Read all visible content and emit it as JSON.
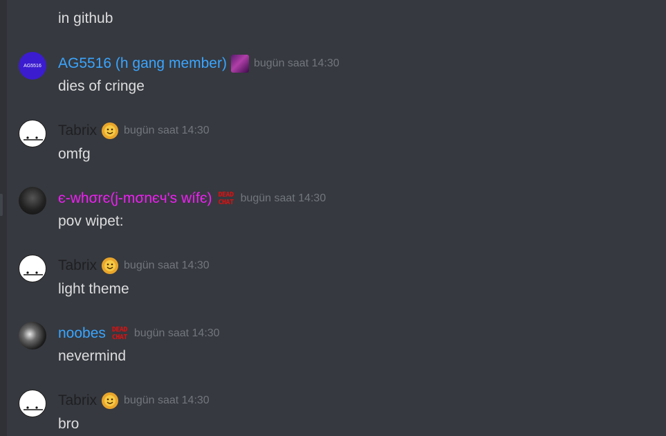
{
  "top_message": {
    "text": "in github"
  },
  "messages": [
    {
      "username": "AG5516 (h gang member)",
      "username_color": "#3aa5ff",
      "avatar_text": "AG5516",
      "badge": "pixel-avatar-badge",
      "timestamp": "bugün saat 14:30",
      "text": "dies of cringe"
    },
    {
      "username": "Tabrix",
      "username_color": "#d9dadc",
      "badge": "sun-emoji-badge",
      "timestamp": "bugün saat 14:30",
      "text": "omfg"
    },
    {
      "username": "є-whσrє(j-mσnєч's wífє)",
      "username_color": "#f01ff5",
      "badge": "dead-chat-badge",
      "badge_text_top": "DEAD",
      "badge_text_bottom": "CHAT",
      "timestamp": "bugün saat 14:30",
      "text": "pov wipet:"
    },
    {
      "username": "Tabrix",
      "username_color": "#d9dadc",
      "badge": "sun-emoji-badge",
      "timestamp": "bugün saat 14:30",
      "text": "light theme"
    },
    {
      "username": "noobes",
      "username_color": "#3aa5ff",
      "badge": "dead-chat-badge",
      "badge_text_top": "DEAD",
      "badge_text_bottom": "CHAT",
      "timestamp": "bugün saat 14:30",
      "text": "nevermind"
    },
    {
      "username": "Tabrix",
      "username_color": "#d9dadc",
      "badge": "sun-emoji-badge",
      "timestamp": "bugün saat 14:30",
      "text": "bro"
    }
  ],
  "colors": {
    "background": "#36393f",
    "text": "#dcddde",
    "timestamp": "#72767d"
  }
}
